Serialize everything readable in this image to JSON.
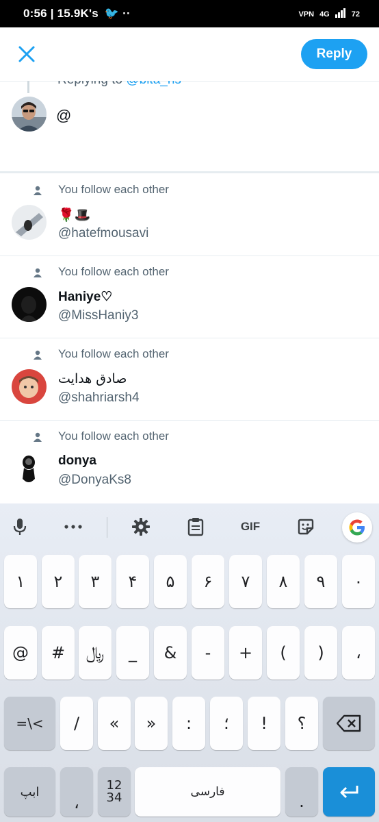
{
  "status_bar": {
    "time": "0:56",
    "notif_text": "| 15.9K's",
    "vpn": "VPN",
    "network": "4G",
    "battery": "72"
  },
  "header": {
    "close_icon": "close-icon",
    "reply_label": "Reply"
  },
  "compose": {
    "replying_prefix": "Replying to",
    "replying_handle": "@bita_hs",
    "text": "@"
  },
  "suggestions": [
    {
      "context": "You follow each other",
      "name": "🌹🎩",
      "handle": "@hatefmousavi"
    },
    {
      "context": "You follow each other",
      "name": "Haniye♡",
      "handle": "@MissHaniy3"
    },
    {
      "context": "You follow each other",
      "name": "صادق هدایت",
      "handle": "@shahriarsh4"
    },
    {
      "context": "You follow each other",
      "name": "donya",
      "handle": "@DonyaKs8"
    }
  ],
  "keyboard": {
    "toolbar": {
      "gif_label": "GIF",
      "icons": [
        "mic-icon",
        "more-icon",
        "settings-icon",
        "clipboard-icon",
        "gif-icon",
        "sticker-icon",
        "google-icon"
      ]
    },
    "row1": [
      "۱",
      "۲",
      "۳",
      "۴",
      "۵",
      "۶",
      "۷",
      "۸",
      "۹",
      "۰"
    ],
    "row2": [
      "@",
      "#",
      "﷼",
      "_",
      "&",
      "-",
      "+",
      "(",
      ")",
      "،"
    ],
    "row3": {
      "shift": "=\\<",
      "keys": [
        "/",
        "«",
        "»",
        ":",
        "؛",
        "!",
        "؟"
      ]
    },
    "row4": {
      "alpha": "ابپ",
      "comma": "،",
      "numbers_top": "12",
      "numbers_bottom": "34",
      "space": "فارسی",
      "period": "."
    }
  },
  "colors": {
    "accent": "#1da1f2",
    "text_secondary": "#536471",
    "enter_key": "#1a8fd8"
  }
}
